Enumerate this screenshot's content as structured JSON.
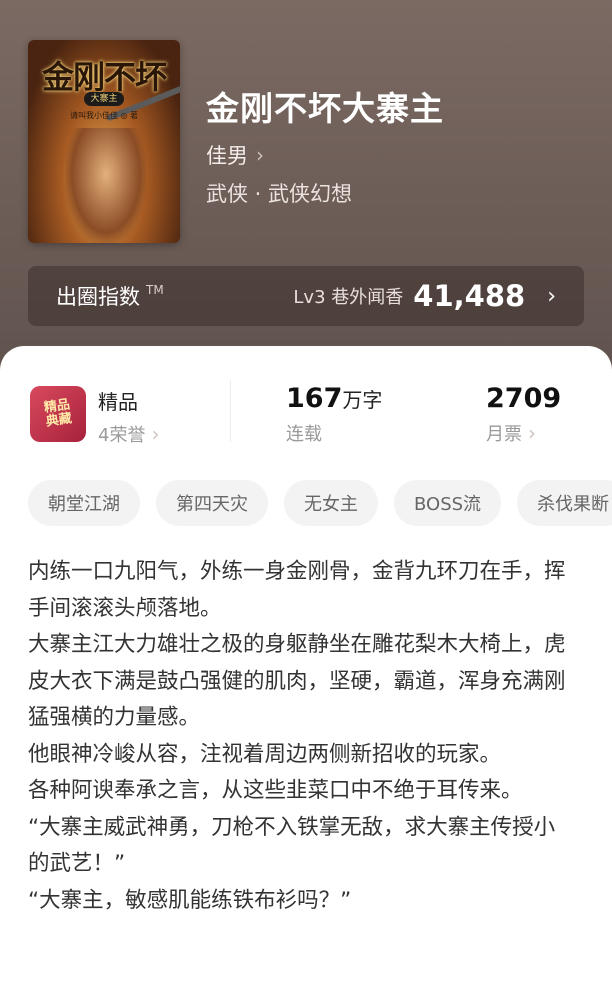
{
  "book": {
    "title": "金刚不坏大寨主",
    "author": "佳男",
    "category": "武侠 · 武侠幻想"
  },
  "cover": {
    "title": "金刚不坏",
    "badge": "大寨主",
    "author_line": "请叫我小佳佳 ◎ 著"
  },
  "rank": {
    "title": "出圈指数",
    "tm": "TM",
    "level": "Lv3 巷外闻香",
    "value": "41,488"
  },
  "stats": {
    "quality_label": "精品",
    "honors": "4荣誉",
    "badge_text": "精品\n典藏",
    "word_count": "167",
    "word_unit": "万字",
    "status": "连载",
    "monthly_votes": "2709",
    "monthly_label": "月票"
  },
  "tags": [
    "朝堂江湖",
    "第四天灾",
    "无女主",
    "BOSS流",
    "杀伐果断"
  ],
  "description": [
    "内练一口九阳气，外练一身金刚骨，金背九环刀在手，挥手间滚滚头颅落地。",
    "大寨主江大力雄壮之极的身躯静坐在雕花梨木大椅上，虎皮大衣下满是鼓凸强健的肌肉，坚硬，霸道，浑身充满刚猛强横的力量感。",
    "他眼神冷峻从容，注视着周边两侧新招收的玩家。",
    "各种阿谀奉承之言，从这些韭菜口中不绝于耳传来。",
    "“大寨主威武神勇，刀枪不入铁掌无敌，求大寨主传授小的武艺！”",
    "“大寨主，敏感肌能练铁布衫吗？”"
  ],
  "colors": {
    "header_bg": "#6f5f59",
    "badge_red": "#c23a50",
    "text_dark": "#333333",
    "text_muted": "#9a9a9a"
  },
  "icons": {
    "chevron": "chevron-right-icon",
    "badge": "quality-badge-icon"
  }
}
